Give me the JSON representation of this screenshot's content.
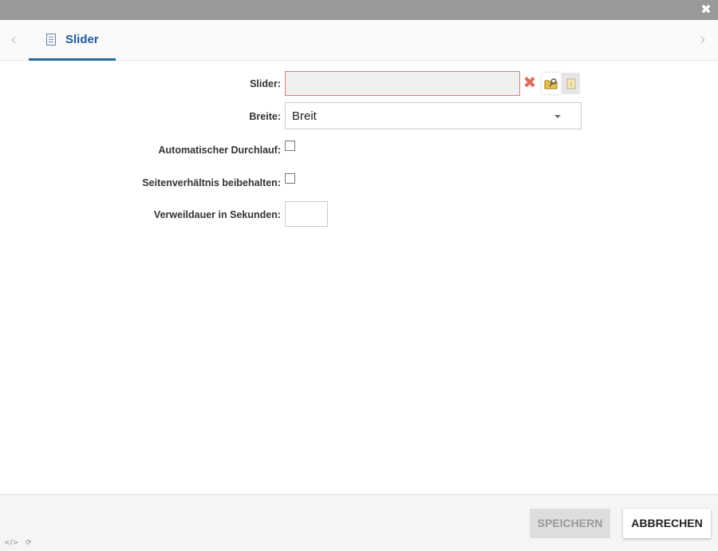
{
  "window": {
    "close_icon": "close-icon"
  },
  "tabs": {
    "active_label": "Slider",
    "tab_icon": "document-icon",
    "accent_color": "#1f6aa1"
  },
  "form": {
    "slider_label": "Slider:",
    "slider_value": "",
    "slider_actions": [
      "delete-icon",
      "browse-folder-icon",
      "info-icon"
    ],
    "width_label": "Breite:",
    "width_value": "Breit",
    "autoplay_label": "Automatischer Durchlauf:",
    "autoplay_checked": false,
    "aspect_label": "Seitenverhältnis beibehalten:",
    "aspect_checked": false,
    "duration_label": "Verweildauer in Sekunden:",
    "duration_value": ""
  },
  "footer": {
    "save_label": "SPEICHERN",
    "cancel_label": "ABBRECHEN",
    "code_icon_glyph": "</>",
    "refresh_icon_glyph": "⟳"
  }
}
